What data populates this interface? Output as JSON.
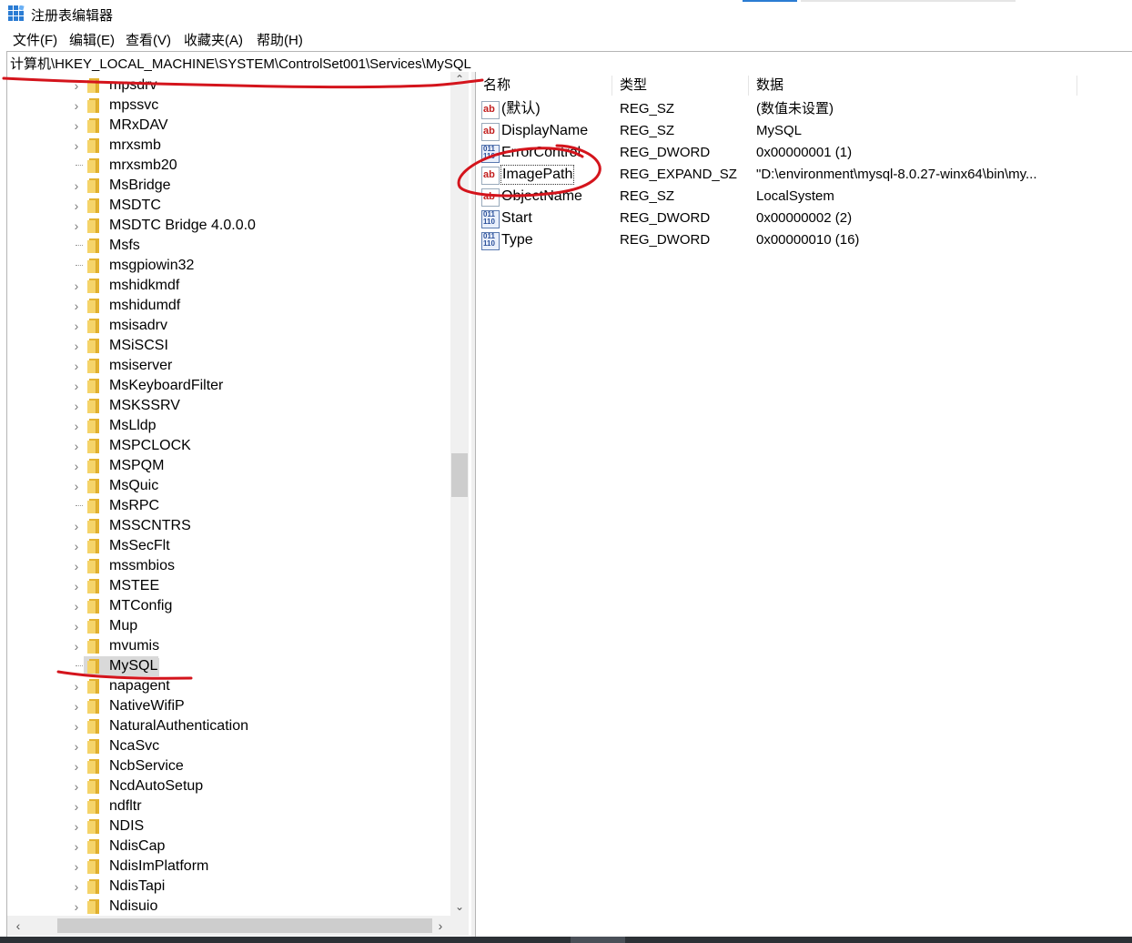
{
  "window": {
    "title": "注册表编辑器",
    "icon": "regedit-icon"
  },
  "menu": [
    "文件(F)",
    "编辑(E)",
    "查看(V)",
    "收藏夹(A)",
    "帮助(H)"
  ],
  "address": "计算机\\HKEY_LOCAL_MACHINE\\SYSTEM\\ControlSet001\\Services\\MySQL",
  "tree": {
    "items": [
      {
        "label": "mpsdrv",
        "expandable": true
      },
      {
        "label": "mpssvc",
        "expandable": true
      },
      {
        "label": "MRxDAV",
        "expandable": true
      },
      {
        "label": "mrxsmb",
        "expandable": true
      },
      {
        "label": "mrxsmb20",
        "expandable": false
      },
      {
        "label": "MsBridge",
        "expandable": true
      },
      {
        "label": "MSDTC",
        "expandable": true
      },
      {
        "label": "MSDTC Bridge 4.0.0.0",
        "expandable": true
      },
      {
        "label": "Msfs",
        "expandable": false
      },
      {
        "label": "msgpiowin32",
        "expandable": false
      },
      {
        "label": "mshidkmdf",
        "expandable": true
      },
      {
        "label": "mshidumdf",
        "expandable": true
      },
      {
        "label": "msisadrv",
        "expandable": true
      },
      {
        "label": "MSiSCSI",
        "expandable": true
      },
      {
        "label": "msiserver",
        "expandable": true
      },
      {
        "label": "MsKeyboardFilter",
        "expandable": true
      },
      {
        "label": "MSKSSRV",
        "expandable": true
      },
      {
        "label": "MsLldp",
        "expandable": true
      },
      {
        "label": "MSPCLOCK",
        "expandable": true
      },
      {
        "label": "MSPQM",
        "expandable": true
      },
      {
        "label": "MsQuic",
        "expandable": true
      },
      {
        "label": "MsRPC",
        "expandable": false
      },
      {
        "label": "MSSCNTRS",
        "expandable": true
      },
      {
        "label": "MsSecFlt",
        "expandable": true
      },
      {
        "label": "mssmbios",
        "expandable": true
      },
      {
        "label": "MSTEE",
        "expandable": true
      },
      {
        "label": "MTConfig",
        "expandable": true
      },
      {
        "label": "Mup",
        "expandable": true
      },
      {
        "label": "mvumis",
        "expandable": true
      },
      {
        "label": "MySQL",
        "expandable": false,
        "selected": true
      },
      {
        "label": "napagent",
        "expandable": true
      },
      {
        "label": "NativeWifiP",
        "expandable": true
      },
      {
        "label": "NaturalAuthentication",
        "expandable": true
      },
      {
        "label": "NcaSvc",
        "expandable": true
      },
      {
        "label": "NcbService",
        "expandable": true
      },
      {
        "label": "NcdAutoSetup",
        "expandable": true
      },
      {
        "label": "ndfltr",
        "expandable": true
      },
      {
        "label": "NDIS",
        "expandable": true
      },
      {
        "label": "NdisCap",
        "expandable": true
      },
      {
        "label": "NdisImPlatform",
        "expandable": true
      },
      {
        "label": "NdisTapi",
        "expandable": true
      },
      {
        "label": "Ndisuio",
        "expandable": true
      }
    ]
  },
  "values": {
    "columns": [
      "名称",
      "类型",
      "数据"
    ],
    "rows": [
      {
        "name": "(默认)",
        "type": "REG_SZ",
        "data": "(数值未设置)",
        "icon": "string-value-icon"
      },
      {
        "name": "DisplayName",
        "type": "REG_SZ",
        "data": "MySQL",
        "icon": "string-value-icon"
      },
      {
        "name": "ErrorControl",
        "type": "REG_DWORD",
        "data": "0x00000001 (1)",
        "icon": "binary-value-icon"
      },
      {
        "name": "ImagePath",
        "type": "REG_EXPAND_SZ",
        "data": "\"D:\\environment\\mysql-8.0.27-winx64\\bin\\my...",
        "icon": "string-value-icon",
        "focused": true
      },
      {
        "name": "ObjectName",
        "type": "REG_SZ",
        "data": "LocalSystem",
        "icon": "string-value-icon"
      },
      {
        "name": "Start",
        "type": "REG_DWORD",
        "data": "0x00000002 (2)",
        "icon": "binary-value-icon"
      },
      {
        "name": "Type",
        "type": "REG_DWORD",
        "data": "0x00000010 (16)",
        "icon": "binary-value-icon"
      }
    ]
  },
  "colors": {
    "annotation_ink": "#d4141c",
    "selection": "#d9d9d9",
    "folder": "#f5d46a"
  }
}
